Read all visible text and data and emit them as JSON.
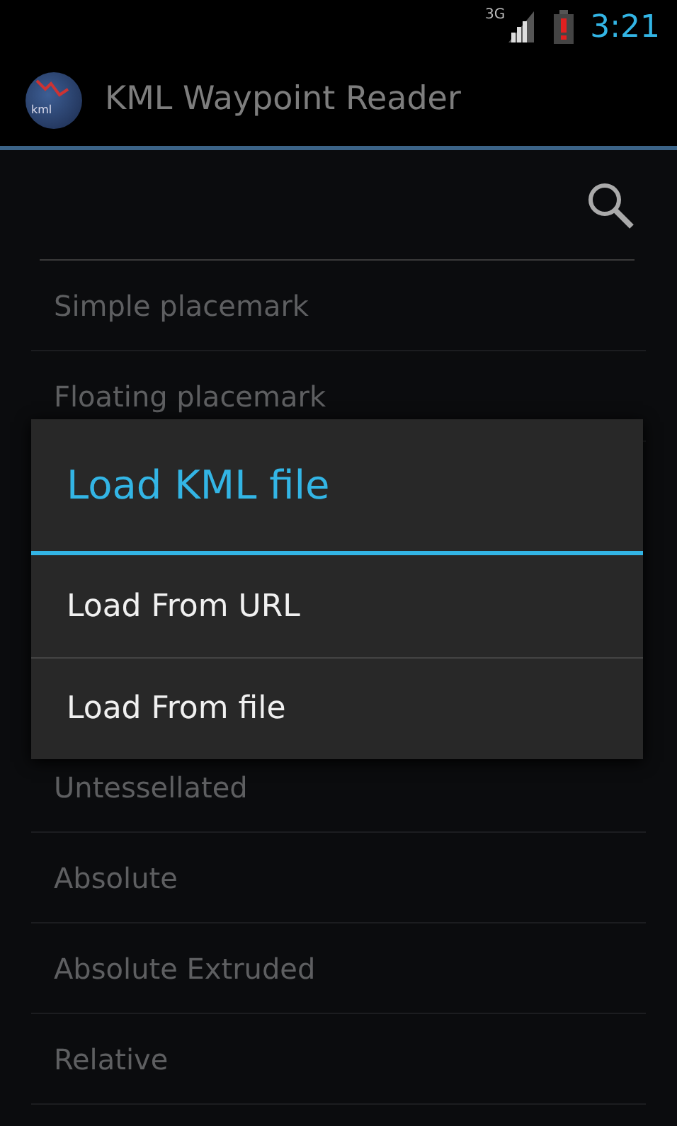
{
  "status_bar": {
    "network": "3G",
    "time": "3:21"
  },
  "action_bar": {
    "icon_label": "kml",
    "title": "KML Waypoint Reader"
  },
  "list_top": [
    "Simple placemark",
    "Floating placemark"
  ],
  "list_bottom": [
    "Untessellated",
    "Absolute",
    "Absolute Extruded",
    "Relative"
  ],
  "dialog": {
    "title": "Load KML file",
    "options": [
      "Load From URL",
      "Load From file"
    ]
  }
}
